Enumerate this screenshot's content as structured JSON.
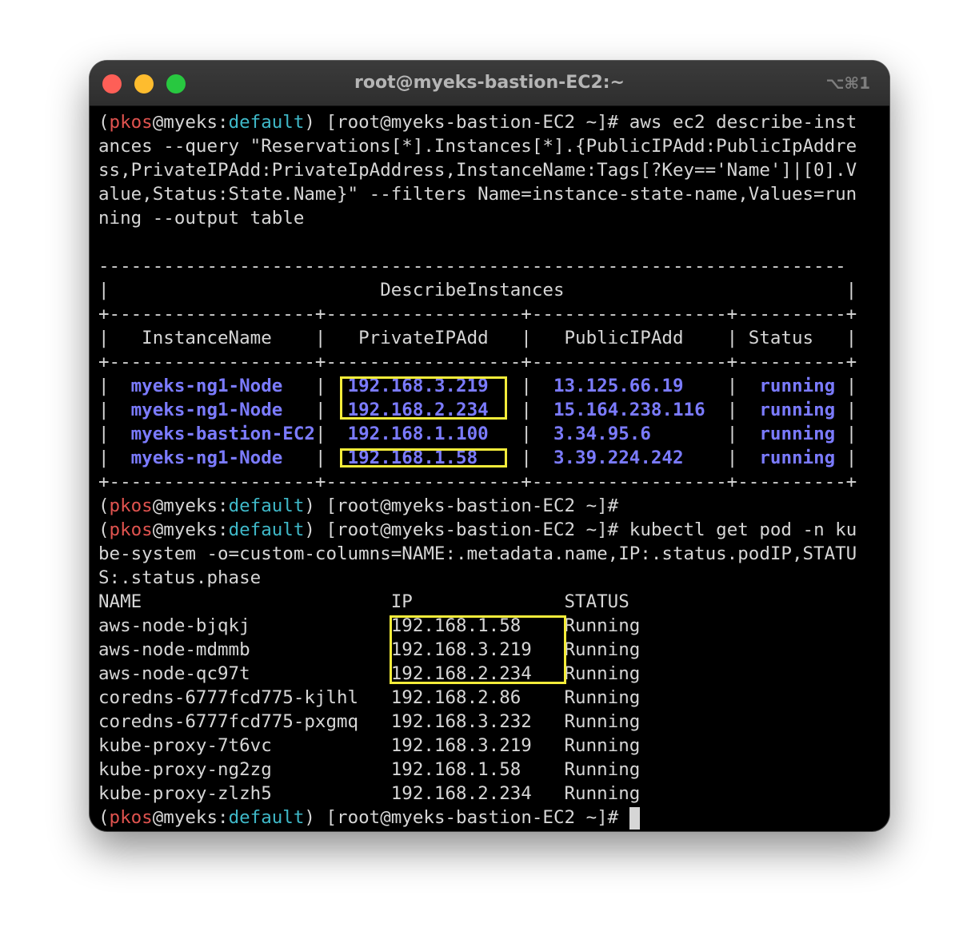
{
  "window": {
    "title": "root@myeks-bastion-EC2:~",
    "shortcut": "⌥⌘1"
  },
  "prompt": {
    "open": "(",
    "user": "pkos",
    "at": "@",
    "host": "myeks",
    "colon": ":",
    "namespace": "default",
    "rest": ") [root@myeks-bastion-EC2 ~]#"
  },
  "command1": {
    "line1": " aws ec2 describe-inst",
    "line2": "ances --query \"Reservations[*].Instances[*].{PublicIPAdd:PublicIpAddre",
    "line3": "ss,PrivateIPAdd:PrivateIpAddress,InstanceName:Tags[?Key=='Name']|[0].V",
    "line4": "alue,Status:State.Name}\" --filters Name=instance-state-name,Values=run",
    "line5": "ning --output table"
  },
  "table": {
    "top_border": "---------------------------------------------------------------------",
    "title_row": "|                         DescribeInstances                          |",
    "separator": "+-------------------+------------------+------------------+----------+",
    "header_row": "|   InstanceName    |   PrivateIPAdd   |   PublicIPAdd    | Status   |",
    "rows": [
      {
        "name": "myeks-ng1-Node",
        "private_ip": "192.168.3.219",
        "public_ip": "13.125.66.19",
        "status": "running"
      },
      {
        "name": "myeks-ng1-Node",
        "private_ip": "192.168.2.234",
        "public_ip": "15.164.238.116",
        "status": "running"
      },
      {
        "name": "myeks-bastion-EC2",
        "private_ip": "192.168.1.100",
        "public_ip": "3.34.95.6",
        "status": "running"
      },
      {
        "name": "myeks-ng1-Node",
        "private_ip": "192.168.1.58",
        "public_ip": "3.39.224.242",
        "status": "running"
      }
    ]
  },
  "command2": {
    "line1": " kubectl get pod -n ku",
    "line2": "be-system -o=custom-columns=NAME:.metadata.name,IP:.status.podIP,STATU",
    "line3": "S:.status.phase"
  },
  "pods": {
    "header": {
      "name": "NAME",
      "ip": "IP",
      "status": "STATUS"
    },
    "rows": [
      {
        "name": "aws-node-bjqkj",
        "ip": "192.168.1.58",
        "status": "Running"
      },
      {
        "name": "aws-node-mdmmb",
        "ip": "192.168.3.219",
        "status": "Running"
      },
      {
        "name": "aws-node-qc97t",
        "ip": "192.168.2.234",
        "status": "Running"
      },
      {
        "name": "coredns-6777fcd775-kjlhl",
        "ip": "192.168.2.86",
        "status": "Running"
      },
      {
        "name": "coredns-6777fcd775-pxgmq",
        "ip": "192.168.3.232",
        "status": "Running"
      },
      {
        "name": "kube-proxy-7t6vc",
        "ip": "192.168.3.219",
        "status": "Running"
      },
      {
        "name": "kube-proxy-ng2zg",
        "ip": "192.168.1.58",
        "status": "Running"
      },
      {
        "name": "kube-proxy-zlzh5",
        "ip": "192.168.2.234",
        "status": "Running"
      }
    ]
  },
  "colors": {
    "prompt_user": "#e0534f",
    "prompt_namespace": "#3fb9c9",
    "highlight_text": "#7b7bff",
    "highlight_box": "#f4ec3a"
  }
}
